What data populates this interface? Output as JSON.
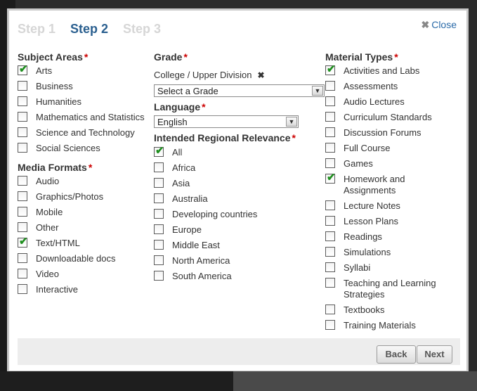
{
  "steps": [
    "Step 1",
    "Step 2",
    "Step 3"
  ],
  "close_label": "Close",
  "close_icon": "close-x-icon",
  "subject_areas": {
    "heading": "Subject Areas",
    "required": "*",
    "items": [
      {
        "label": "Arts",
        "checked": true
      },
      {
        "label": "Business",
        "checked": false
      },
      {
        "label": "Humanities",
        "checked": false
      },
      {
        "label": "Mathematics and Statistics",
        "checked": false
      },
      {
        "label": "Science and Technology",
        "checked": false
      },
      {
        "label": "Social Sciences",
        "checked": false
      }
    ]
  },
  "media_formats": {
    "heading": "Media Formats",
    "required": "*",
    "items": [
      {
        "label": "Audio",
        "checked": false
      },
      {
        "label": "Graphics/Photos",
        "checked": false
      },
      {
        "label": "Mobile",
        "checked": false
      },
      {
        "label": "Other",
        "checked": false
      },
      {
        "label": "Text/HTML",
        "checked": true
      },
      {
        "label": "Downloadable docs",
        "checked": false
      },
      {
        "label": "Video",
        "checked": false
      },
      {
        "label": "Interactive",
        "checked": false
      }
    ]
  },
  "grade": {
    "heading": "Grade",
    "required": "*",
    "selected_tag": "College / Upper Division",
    "remove_glyph": "✖",
    "select_value": "Select a Grade"
  },
  "language": {
    "heading": "Language",
    "required": "*",
    "select_value": "English"
  },
  "regional": {
    "heading": "Intended Regional Relevance",
    "required": "*",
    "items": [
      {
        "label": "All",
        "checked": true
      },
      {
        "label": "Africa",
        "checked": false
      },
      {
        "label": "Asia",
        "checked": false
      },
      {
        "label": "Australia",
        "checked": false
      },
      {
        "label": "Developing countries",
        "checked": false
      },
      {
        "label": "Europe",
        "checked": false
      },
      {
        "label": "Middle East",
        "checked": false
      },
      {
        "label": "North America",
        "checked": false
      },
      {
        "label": "South America",
        "checked": false
      }
    ]
  },
  "material_types": {
    "heading": "Material Types",
    "required": "*",
    "items": [
      {
        "label": "Activities and Labs",
        "checked": true
      },
      {
        "label": "Assessments",
        "checked": false
      },
      {
        "label": "Audio Lectures",
        "checked": false
      },
      {
        "label": "Curriculum Standards",
        "checked": false
      },
      {
        "label": "Discussion Forums",
        "checked": false
      },
      {
        "label": "Full Course",
        "checked": false
      },
      {
        "label": "Games",
        "checked": false
      },
      {
        "label": "Homework and Assignments",
        "checked": true
      },
      {
        "label": "Lecture Notes",
        "checked": false
      },
      {
        "label": "Lesson Plans",
        "checked": false
      },
      {
        "label": "Readings",
        "checked": false
      },
      {
        "label": "Simulations",
        "checked": false
      },
      {
        "label": "Syllabi",
        "checked": false
      },
      {
        "label": "Teaching and Learning Strategies",
        "checked": false
      },
      {
        "label": "Textbooks",
        "checked": false
      },
      {
        "label": "Training Materials",
        "checked": false
      }
    ]
  },
  "buttons": {
    "back": "Back",
    "next": "Next"
  },
  "colors": {
    "accent": "#2a5f8f",
    "required": "#cc0000",
    "check": "#1e8f1e",
    "inactive_step": "#d6d6d6"
  }
}
